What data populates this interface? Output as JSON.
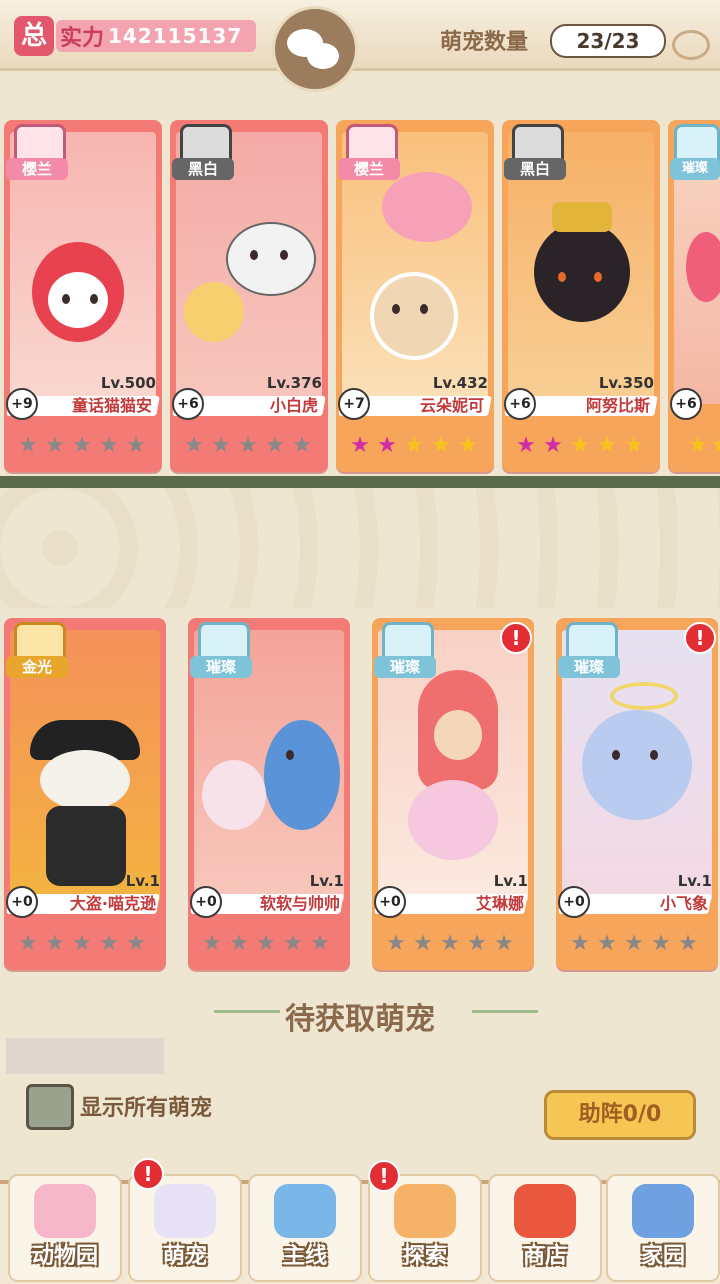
{
  "header": {
    "total_badge": "总",
    "power_label": "实力",
    "power_value": "142115137",
    "pet_count_label": "萌宠数量",
    "pet_count_value": "23/23"
  },
  "owned_cards": [
    {
      "rarity": "樱兰",
      "plus": "+9",
      "level": "Lv.500",
      "name": "童话猫猫安",
      "stars": [
        "gray",
        "gray",
        "gray",
        "gray",
        "gray"
      ]
    },
    {
      "rarity": "黑白",
      "plus": "+6",
      "level": "Lv.376",
      "name": "小白虎",
      "stars": [
        "gray",
        "gray",
        "gray",
        "gray",
        "gray"
      ]
    },
    {
      "rarity": "樱兰",
      "plus": "+7",
      "level": "Lv.432",
      "name": "云朵妮可",
      "stars": [
        "purple",
        "purple",
        "gold",
        "gold",
        "gold"
      ]
    },
    {
      "rarity": "黑白",
      "plus": "+6",
      "level": "Lv.350",
      "name": "阿努比斯",
      "stars": [
        "purple",
        "purple",
        "gold",
        "gold",
        "gold"
      ]
    },
    {
      "rarity": "璀璨",
      "plus": "+6",
      "level": "",
      "name": "",
      "stars": [
        "gold",
        "gold"
      ]
    }
  ],
  "unowned_cards": [
    {
      "rarity": "金光",
      "plus": "+0",
      "level": "Lv.1",
      "name": "大盗·喵克逊",
      "stars": [
        "gray",
        "gray",
        "gray",
        "gray",
        "gray"
      ],
      "alert": false
    },
    {
      "rarity": "璀璨",
      "plus": "+0",
      "level": "Lv.1",
      "name": "软软与帅帅",
      "stars": [
        "gray",
        "gray",
        "gray",
        "gray",
        "gray"
      ],
      "alert": false
    },
    {
      "rarity": "璀璨",
      "plus": "+0",
      "level": "Lv.1",
      "name": "艾琳娜",
      "stars": [
        "gray",
        "gray",
        "gray",
        "gray",
        "gray"
      ],
      "alert": true
    },
    {
      "rarity": "璀璨",
      "plus": "+0",
      "level": "Lv.1",
      "name": "小飞象",
      "stars": [
        "gray",
        "gray",
        "gray",
        "gray",
        "gray"
      ],
      "alert": true
    }
  ],
  "section_title": "待获取萌宠",
  "show_all_label": "显示所有萌宠",
  "assist_button": "助阵0/0",
  "alert_mark": "!",
  "bottom_nav": [
    {
      "label": "动物园",
      "icon": "zoo-icon",
      "alert": false
    },
    {
      "label": "萌宠",
      "icon": "pets-icon",
      "alert": true
    },
    {
      "label": "主线",
      "icon": "paw-task-icon",
      "alert": false
    },
    {
      "label": "探索",
      "icon": "explore-cat-icon",
      "alert": true
    },
    {
      "label": "商店",
      "icon": "shop-icon",
      "alert": false
    },
    {
      "label": "家园",
      "icon": "home-icon",
      "alert": false
    }
  ],
  "colors": {
    "rarity_sakura": "#f6a5c0",
    "rarity_bw": "#8a8a8a",
    "rarity_brilliant": "#9bd4e6",
    "rarity_gold": "#f2b63a"
  }
}
